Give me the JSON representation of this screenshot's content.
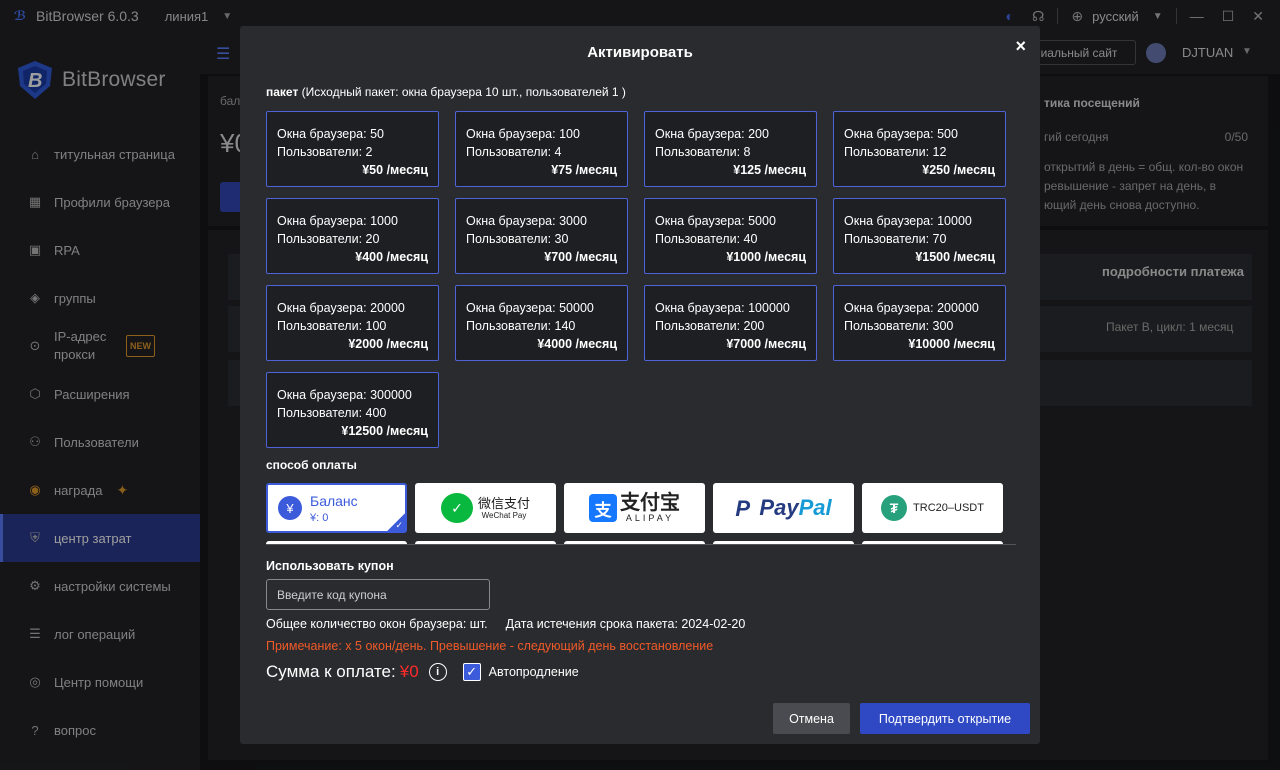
{
  "app": {
    "title": "BitBrowser 6.0.3",
    "line": "линия1",
    "language": "русский",
    "brand": "BitBrowser"
  },
  "sidebar": {
    "items": [
      {
        "label": "титульная страница",
        "icon": "home-icon"
      },
      {
        "label": "Профили браузера",
        "icon": "grid-icon"
      },
      {
        "label": "RPA",
        "icon": "robot-icon"
      },
      {
        "label": "группы",
        "icon": "layers-icon"
      },
      {
        "label": "IP-адрес прокси",
        "icon": "location-icon",
        "badge": "NEW"
      },
      {
        "label": "Расширения",
        "icon": "cube-icon"
      },
      {
        "label": "Пользователи",
        "icon": "users-icon"
      },
      {
        "label": "награда",
        "icon": "reward-icon"
      },
      {
        "label": "центр затрат",
        "icon": "shield-icon",
        "active": true
      },
      {
        "label": "настройки системы",
        "icon": "settings-icon"
      },
      {
        "label": "лог операций",
        "icon": "log-icon"
      },
      {
        "label": "Центр помощи",
        "icon": "help-icon"
      },
      {
        "label": "вопрос",
        "icon": "question-icon"
      }
    ]
  },
  "header": {
    "site_button": "иальный сайт",
    "user": "DJTUAN"
  },
  "background": {
    "balance_label": "бал",
    "yen": "¥0",
    "stats_title": "тика посещений",
    "today_label": "гий сегодня",
    "today_value": "0/50",
    "desc": [
      "открытий в день = общ. кол-во окон",
      "ревышение - запрет на день, в",
      "ющий день снова доступно."
    ],
    "details_header": "подробности платежа",
    "details_row": "Пакет B, цикл: 1 месяц"
  },
  "modal": {
    "title": "Активировать",
    "close": "×",
    "package_label": "пакет",
    "package_note": "(Исходный пакет: окна браузера 10 шт., пользователей 1 )",
    "packages": [
      {
        "windows": "Окна браузера: 50",
        "users": "Пользователи: 2",
        "price": "¥50 /месяц"
      },
      {
        "windows": "Окна браузера: 100",
        "users": "Пользователи: 4",
        "price": "¥75 /месяц"
      },
      {
        "windows": "Окна браузера: 200",
        "users": "Пользователи: 8",
        "price": "¥125 /месяц"
      },
      {
        "windows": "Окна браузера: 500",
        "users": "Пользователи: 12",
        "price": "¥250 /месяц"
      },
      {
        "windows": "Окна браузера: 1000",
        "users": "Пользователи: 20",
        "price": "¥400 /месяц"
      },
      {
        "windows": "Окна браузера: 3000",
        "users": "Пользователи: 30",
        "price": "¥700 /месяц"
      },
      {
        "windows": "Окна браузера: 5000",
        "users": "Пользователи: 40",
        "price": "¥1000 /месяц"
      },
      {
        "windows": "Окна браузера: 10000",
        "users": "Пользователи: 70",
        "price": "¥1500 /месяц"
      },
      {
        "windows": "Окна браузера: 20000",
        "users": "Пользователи: 100",
        "price": "¥2000 /месяц"
      },
      {
        "windows": "Окна браузера: 50000",
        "users": "Пользователи: 140",
        "price": "¥4000 /месяц"
      },
      {
        "windows": "Окна браузера: 100000",
        "users": "Пользователи: 200",
        "price": "¥7000 /месяц"
      },
      {
        "windows": "Окна браузера: 200000",
        "users": "Пользователи: 300",
        "price": "¥10000 /месяц"
      },
      {
        "windows": "Окна браузера: 300000",
        "users": "Пользователи: 400",
        "price": "¥12500 /месяц"
      }
    ],
    "payment_label": "способ оплаты",
    "payment": {
      "balance_name": "Баланс",
      "balance_value": "¥: 0",
      "wechat_cn": "微信支付",
      "wechat_en": "WeChat Pay",
      "alipay_cn": "支付宝",
      "alipay_en": "ALIPAY",
      "paypal_a": "Pay",
      "paypal_b": "Pal",
      "usdt": "TRC20–USDT"
    },
    "coupon_label": "Использовать купон",
    "coupon_placeholder": "Введите код купона",
    "total_windows": "Общее количество окон браузера: шт.",
    "expiry": "Дата истечения срока пакета: 2024-02-20",
    "note": "Примечание: x 5 окон/день. Превышение - следующий день восстановление",
    "sum_label": "Сумма к оплате:",
    "sum_value": "¥0",
    "autorenew": "Автопродление",
    "cancel": "Отмена",
    "confirm": "Подтвердить открытие"
  }
}
